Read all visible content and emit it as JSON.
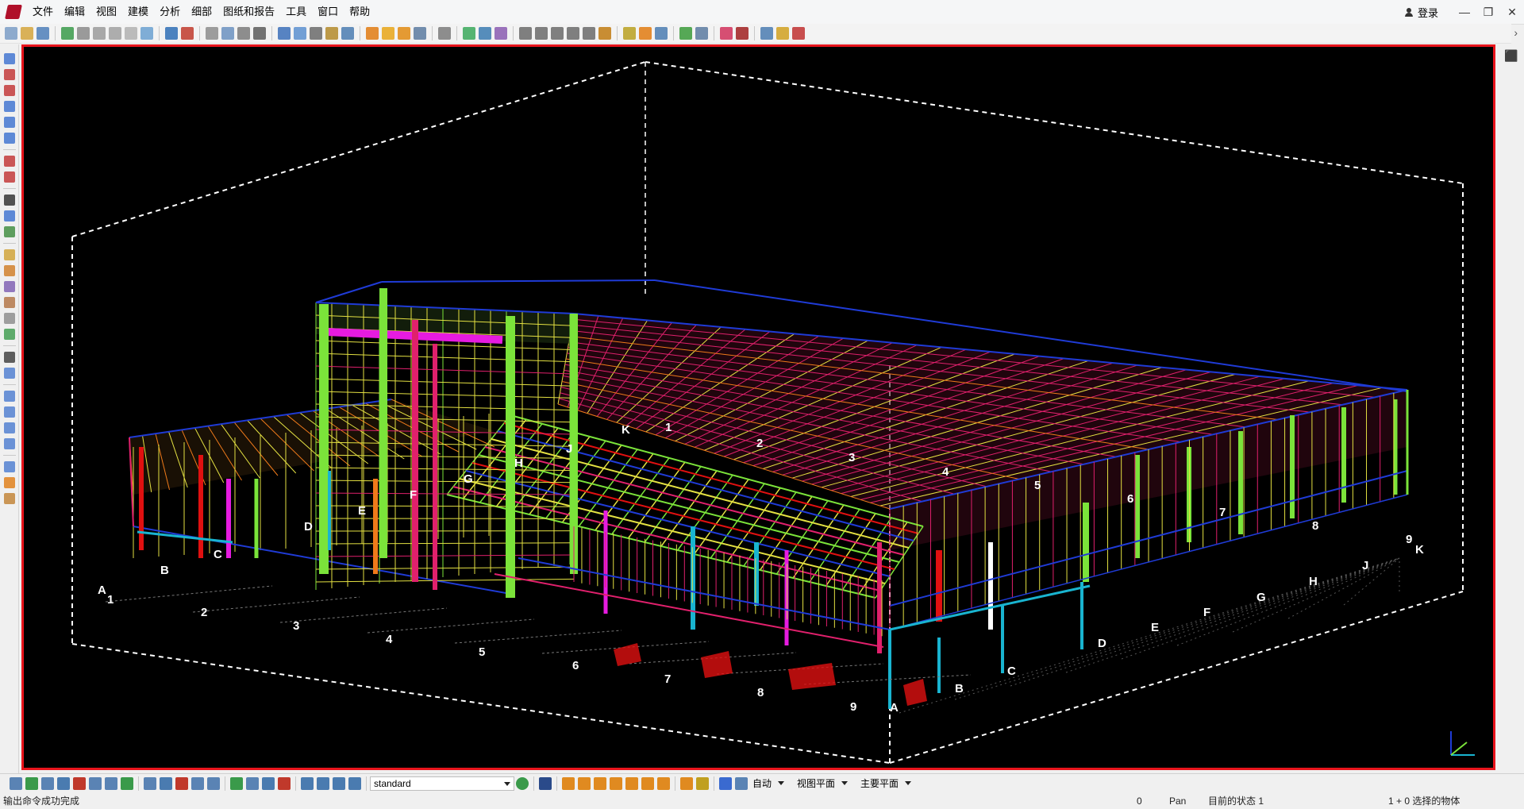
{
  "menu": [
    "文件",
    "编辑",
    "视图",
    "建模",
    "分析",
    "细部",
    "图纸和报告",
    "工具",
    "窗口",
    "帮助"
  ],
  "login_label": "登录",
  "window_controls": {
    "minimize": "—",
    "restore": "❐",
    "close": "✕"
  },
  "toolbar_icons": [
    "new-file",
    "open-folder",
    "save",
    "share",
    "model-cube",
    "model-grey",
    "model-grey2",
    "model-grey3",
    "model-box",
    "undo",
    "redo",
    "copy-special",
    "move",
    "copy",
    "properties",
    "view-window",
    "view-rect",
    "view-list",
    "cut",
    "snap",
    "drawing-orange",
    "drawing-yellow",
    "drawing-orange2",
    "drawing-list",
    "measure",
    "ref-model",
    "ref-model2",
    "user-mode",
    "grid",
    "grid-line",
    "dimension",
    "tool-edge",
    "tool-arc",
    "tool-stamp",
    "phase",
    "clash",
    "assign",
    "green-arrow",
    "catalog",
    "pink-box",
    "red-people",
    "double-chevron",
    "yellow-run",
    "red-app"
  ],
  "left_tools": [
    "line-tool",
    "line-tool2",
    "line-tool3",
    "line-tool4",
    "line-tool5",
    "point-tool",
    "line-tool6",
    "circle-tool",
    "binoculars",
    "profile",
    "bolt",
    "plate",
    "column",
    "weld",
    "material",
    "part",
    "group",
    "explode",
    "beam-blue",
    "beam-blue2",
    "bent-plate",
    "polybeam",
    "curve-beam",
    "spiral",
    "panel",
    "pad"
  ],
  "viewport": {
    "border_color": "#e8141c",
    "background": "#000000",
    "grid_numbers": [
      "1",
      "2",
      "3",
      "4",
      "5",
      "6",
      "7",
      "8",
      "9"
    ],
    "grid_letters": [
      "A",
      "B",
      "C",
      "D",
      "E",
      "F",
      "G",
      "H",
      "J",
      "K"
    ],
    "colors": {
      "green": "#7be33a",
      "pink": "#e0206c",
      "blue": "#1f3bd6",
      "yellow": "#e4e142",
      "cyan": "#19b4d0",
      "magenta": "#e61be0",
      "red": "#e01010",
      "orange": "#ef7a1a",
      "white": "#ffffff"
    }
  },
  "bottom": {
    "filter_value": "standard",
    "auto_label": "自动",
    "view_plane": "视图平面",
    "main_plane": "主要平面"
  },
  "status": {
    "message": "输出命令成功完成",
    "count": "0",
    "mode": "Pan",
    "state": "目前的状态 1",
    "selection": "1 + 0 选择的物体"
  }
}
